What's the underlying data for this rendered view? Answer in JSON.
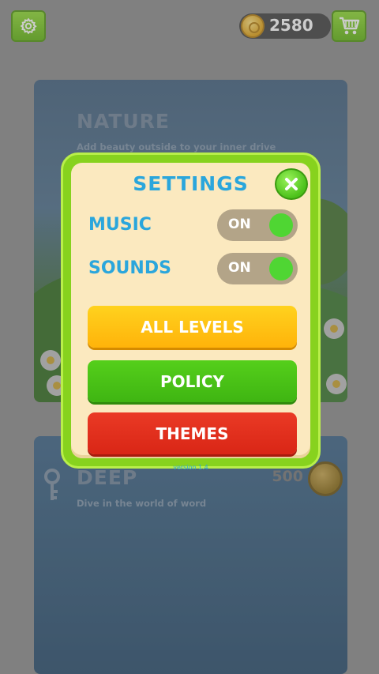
{
  "topbar": {
    "coins": "2580",
    "gear_icon": "gear-icon",
    "cart_icon": "cart-icon"
  },
  "levels": [
    {
      "title": "NATURE",
      "subtitle": "Add beauty outside to your inner drive"
    },
    {
      "title": "DEEP",
      "subtitle": "Dive in the world of word",
      "price": "500",
      "lock_icon": "key-icon"
    }
  ],
  "settings": {
    "title": "SETTINGS",
    "music_label": "MUSIC",
    "music_toggle": "ON",
    "sounds_label": "SOUNDS",
    "sounds_toggle": "ON",
    "all_levels_label": "ALL LEVELS",
    "policy_label": "POLICY",
    "themes_label": "THEMES",
    "version": "version 1.4"
  },
  "colors": {
    "accent_blue": "#2aa6dc",
    "dialog_green": "#87d21e",
    "toggle_on": "#4fd633",
    "btn_yellow": "#ffc010",
    "btn_green": "#47c015",
    "btn_red": "#e0301c"
  }
}
